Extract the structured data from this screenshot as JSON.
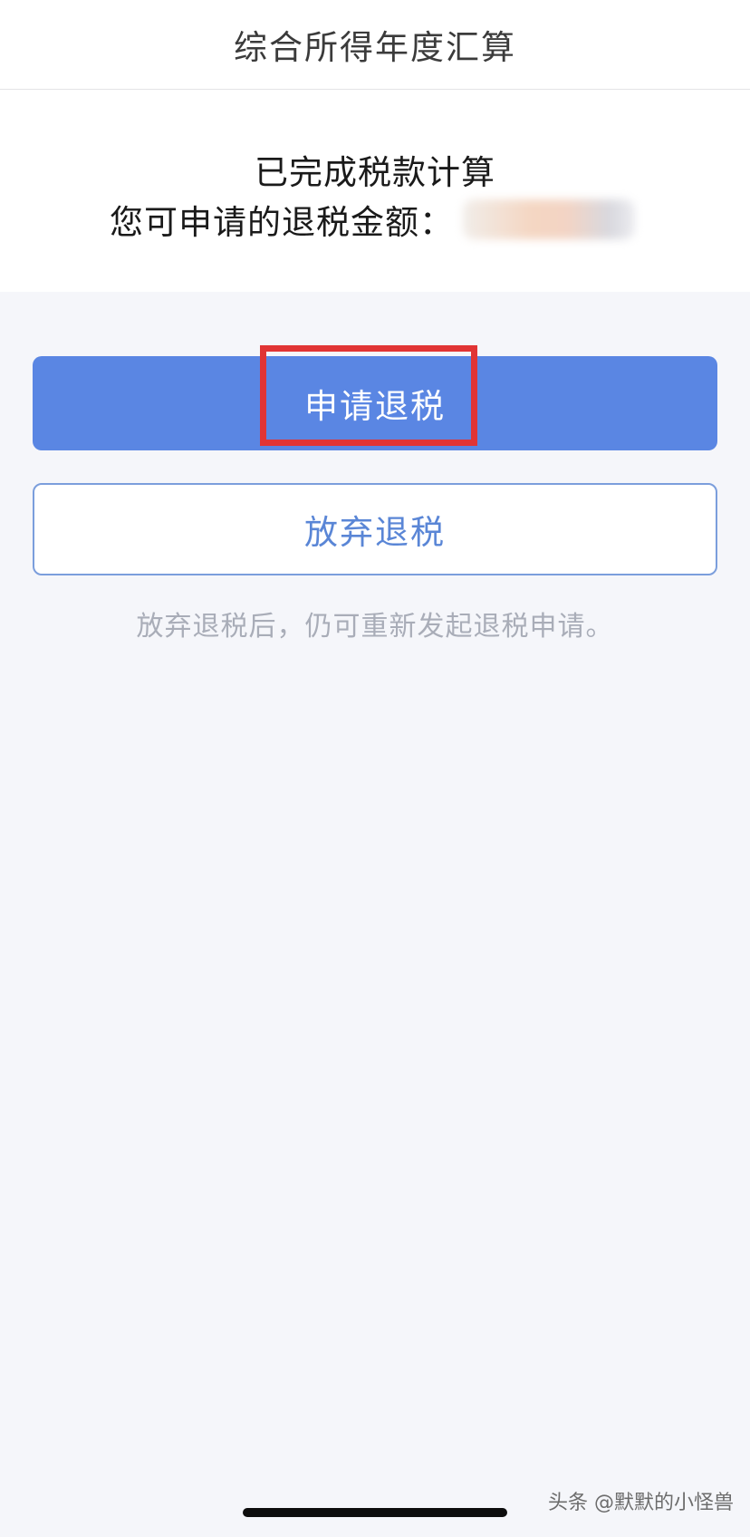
{
  "navbar": {
    "title": "综合所得年度汇算"
  },
  "result": {
    "title": "已完成税款计算",
    "refund_label": "您可申请的退税金额："
  },
  "actions": {
    "apply_label": "申请退税",
    "giveup_label": "放弃退税",
    "hint": "放弃退税后，仍可重新发起退税申请。"
  },
  "watermark": "头条 @默默的小怪兽",
  "colors": {
    "primary": "#5a86e3",
    "highlight": "#e13434",
    "background": "#f5f6fa"
  }
}
